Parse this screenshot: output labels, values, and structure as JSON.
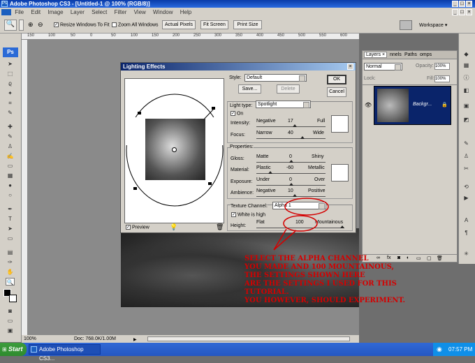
{
  "window": {
    "title": "Adobe Photoshop CS3 - [Untitled-1 @ 100% (RGB/8)]",
    "app_icon": "Ps"
  },
  "menu": [
    "File",
    "Edit",
    "Image",
    "Layer",
    "Select",
    "Filter",
    "View",
    "Window",
    "Help"
  ],
  "options": {
    "resize_windows": "Resize Windows To Fit",
    "zoom_all": "Zoom All Windows",
    "actual_pixels": "Actual Pixels",
    "fit_screen": "Fit Screen",
    "print_size": "Print Size",
    "workspace": "Workspace"
  },
  "ruler": [
    "150",
    "100",
    "50",
    "0",
    "50",
    "100",
    "150",
    "200",
    "250",
    "300",
    "350",
    "400",
    "450",
    "500",
    "550",
    "600"
  ],
  "status": {
    "zoom": "100%",
    "doc": "Doc: 768.0K/1.00M"
  },
  "layers_panel": {
    "tabs": [
      "Layers",
      "nnels",
      "Paths",
      "omps"
    ],
    "blend_mode": "Normal",
    "opacity_label": "Opacity:",
    "opacity_value": "100%",
    "lock_label": "Lock:",
    "fill_label": "Fill:",
    "fill_value": "100%",
    "layer_name": "Backgr..."
  },
  "dialog": {
    "title": "Lighting Effects",
    "style_label": "Style:",
    "style_value": "Default",
    "save": "Save...",
    "delete": "Delete",
    "ok": "OK",
    "cancel": "Cancel",
    "light_type_label": "Light type:",
    "light_type_value": "Spotlight",
    "on_label": "On",
    "intensity": {
      "label": "Intensity:",
      "min": "Negative",
      "value": "17",
      "max": "Full"
    },
    "focus": {
      "label": "Focus:",
      "min": "Narrow",
      "value": "40",
      "max": "Wide"
    },
    "properties_label": "Properties:",
    "gloss": {
      "label": "Gloss:",
      "min": "Matte",
      "value": "0",
      "max": "Shiny"
    },
    "material": {
      "label": "Material:",
      "min": "Plastic",
      "value": "-60",
      "max": "Metallic"
    },
    "exposure": {
      "label": "Exposure:",
      "min": "Under",
      "value": "0",
      "max": "Over"
    },
    "ambience": {
      "label": "Ambience:",
      "min": "Negative",
      "value": "10",
      "max": "Positive"
    },
    "texture_label": "Texture Channel:",
    "texture_value": "Alpha 1",
    "white_high": "White is high",
    "height": {
      "label": "Height:",
      "min": "Flat",
      "value": "100",
      "max": "Mountainous"
    },
    "preview_label": "Preview"
  },
  "annotation": [
    "Select the alpha channel",
    "you made and 100 mountainous,",
    "the settings shown here",
    "are the settings I used for this",
    "tutorial.",
    "you however, should experiment."
  ],
  "taskbar": {
    "start": "Start",
    "item": "Adobe Photoshop CS3...",
    "clock": "07:57 PM"
  }
}
